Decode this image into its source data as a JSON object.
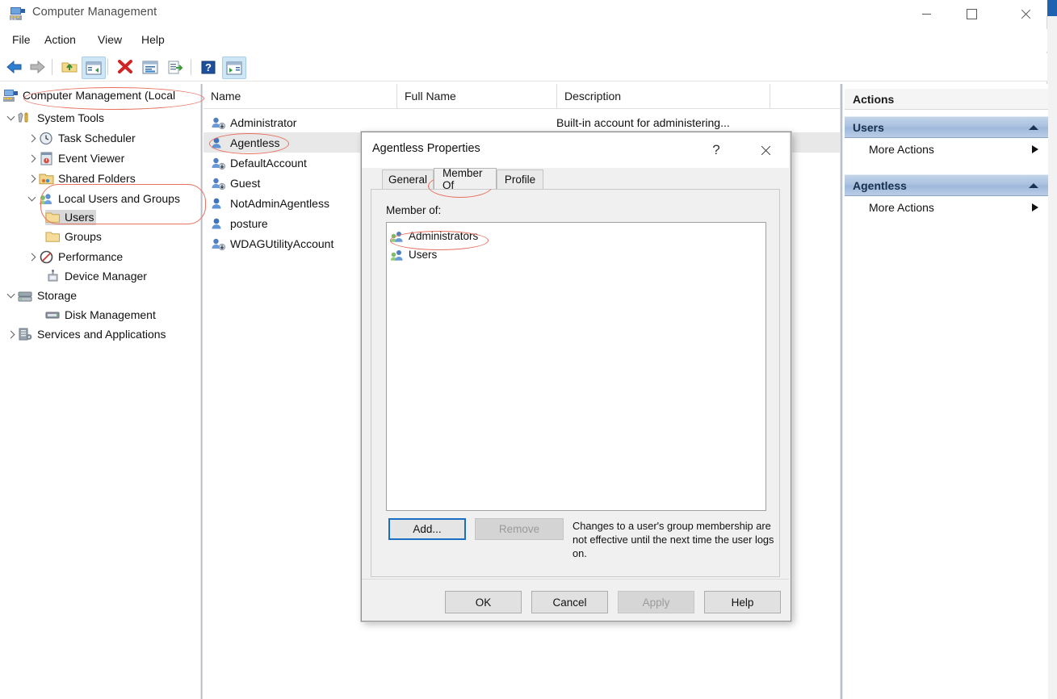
{
  "window": {
    "title": "Computer Management",
    "icon": "computer-management-icon",
    "controls": {
      "minimize": "–",
      "maximize": "□",
      "close": "✕"
    }
  },
  "menubar": {
    "items": [
      "File",
      "Action",
      "View",
      "Help"
    ]
  },
  "toolbar": {
    "buttons": [
      {
        "name": "back-icon",
        "label": "Back"
      },
      {
        "name": "forward-icon",
        "label": "Forward"
      },
      {
        "name": "up-folder-icon",
        "label": "Up One Level"
      },
      {
        "name": "show-hide-console-tree-icon",
        "label": "Show/Hide Console Tree"
      },
      {
        "name": "delete-icon",
        "label": "Delete"
      },
      {
        "name": "properties-icon",
        "label": "Properties"
      },
      {
        "name": "export-list-icon",
        "label": "Export List"
      },
      {
        "name": "help-icon",
        "label": "Help"
      },
      {
        "name": "show-hide-action-pane-icon",
        "label": "Show/Hide Action Pane"
      }
    ]
  },
  "tree": {
    "root": {
      "label": "Computer Management (Local",
      "icon": "computer-management-icon"
    },
    "items": [
      {
        "label": "System Tools",
        "icon": "system-tools-icon",
        "indent": 1,
        "expander": "expanded"
      },
      {
        "label": "Task Scheduler",
        "icon": "clock-icon",
        "indent": 2,
        "expander": "collapsed"
      },
      {
        "label": "Event Viewer",
        "icon": "event-viewer-icon",
        "indent": 2,
        "expander": "collapsed"
      },
      {
        "label": "Shared Folders",
        "icon": "shared-folders-icon",
        "indent": 2,
        "expander": "collapsed"
      },
      {
        "label": "Local Users and Groups",
        "icon": "users-groups-icon",
        "indent": 2,
        "expander": "expanded"
      },
      {
        "label": "Users",
        "icon": "folder-icon",
        "indent": 3,
        "expander": "none",
        "selected": true
      },
      {
        "label": "Groups",
        "icon": "folder-icon",
        "indent": 3,
        "expander": "none"
      },
      {
        "label": "Performance",
        "icon": "performance-icon",
        "indent": 2,
        "expander": "collapsed"
      },
      {
        "label": "Device Manager",
        "icon": "device-manager-icon",
        "indent": 2,
        "expander": "none"
      },
      {
        "label": "Storage",
        "icon": "storage-icon",
        "indent": 1,
        "expander": "expanded"
      },
      {
        "label": "Disk Management",
        "icon": "disk-management-icon",
        "indent": 2,
        "expander": "none"
      },
      {
        "label": "Services and Applications",
        "icon": "services-icon",
        "indent": 1,
        "expander": "collapsed"
      }
    ]
  },
  "list": {
    "columns": [
      "Name",
      "Full Name",
      "Description"
    ],
    "rows": [
      {
        "name": "Administrator",
        "full_name": "",
        "description": "Built-in account for administering...",
        "icon": "user-account-icon",
        "selected": false
      },
      {
        "name": "Agentless",
        "full_name": "",
        "description": "",
        "icon": "user-account-plain-icon",
        "selected": true
      },
      {
        "name": "DefaultAccount",
        "full_name": "",
        "description": "",
        "icon": "user-account-icon",
        "selected": false
      },
      {
        "name": "Guest",
        "full_name": "",
        "description": "",
        "icon": "user-account-icon",
        "selected": false
      },
      {
        "name": "NotAdminAgentless",
        "full_name": "",
        "description": "",
        "icon": "user-account-plain-icon",
        "selected": false
      },
      {
        "name": "posture",
        "full_name": "",
        "description": "",
        "icon": "user-account-plain-icon",
        "selected": false
      },
      {
        "name": "WDAGUtilityAccount",
        "full_name": "",
        "description": "",
        "icon": "user-account-icon",
        "selected": false
      }
    ]
  },
  "actions": {
    "title": "Actions",
    "groups": [
      {
        "title": "Users",
        "items": [
          {
            "label": "More Actions",
            "submenu": true
          }
        ]
      },
      {
        "title": "Agentless",
        "items": [
          {
            "label": "More Actions",
            "submenu": true
          }
        ]
      }
    ]
  },
  "dialog": {
    "title": "Agentless Properties",
    "help_glyph": "?",
    "close_glyph": "✕",
    "tabs": [
      {
        "label": "General",
        "active": false
      },
      {
        "label": "Member Of",
        "active": true
      },
      {
        "label": "Profile",
        "active": false
      }
    ],
    "member_of_label": "Member of:",
    "members": [
      {
        "label": "Administrators",
        "icon": "group-icon"
      },
      {
        "label": "Users",
        "icon": "group-icon"
      }
    ],
    "add_button": "Add...",
    "remove_button": "Remove",
    "hint": "Changes to a user's group membership are not effective until the next time the user logs on.",
    "footer_buttons": [
      {
        "label": "OK",
        "disabled": false
      },
      {
        "label": "Cancel",
        "disabled": false
      },
      {
        "label": "Apply",
        "disabled": true
      },
      {
        "label": "Help",
        "disabled": false
      }
    ]
  },
  "annotations": {
    "color": "#e8705f",
    "targets": [
      "root-node",
      "tree-users-group",
      "list-row-agentless",
      "tab-member-of",
      "member-administrators"
    ]
  }
}
